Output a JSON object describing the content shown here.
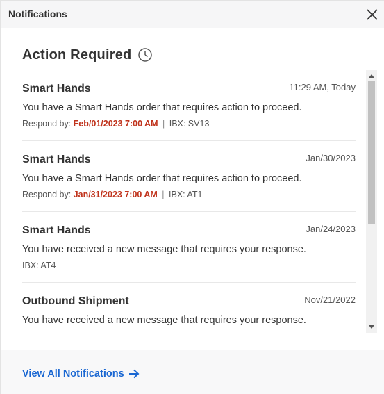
{
  "header": {
    "title": "Notifications"
  },
  "section": {
    "title": "Action Required"
  },
  "items": [
    {
      "title": "Smart Hands",
      "date": "11:29 AM, Today",
      "message": "You have a Smart Hands order that requires action to proceed.",
      "respond_label": "Respond by:",
      "respond_date": "Feb/01/2023 7:00 AM",
      "separator": "|",
      "ibx": "IBX: SV13"
    },
    {
      "title": "Smart Hands",
      "date": "Jan/30/2023",
      "message": "You have a Smart Hands order that requires action to proceed.",
      "respond_label": "Respond by:",
      "respond_date": "Jan/31/2023 7:00 AM",
      "separator": "|",
      "ibx": "IBX: AT1"
    },
    {
      "title": "Smart Hands",
      "date": "Jan/24/2023",
      "message": "You have received a new message that requires your response.",
      "ibx": "IBX: AT4"
    },
    {
      "title": "Outbound Shipment",
      "date": "Nov/21/2022",
      "message": "You have received a new message that requires your response."
    }
  ],
  "footer": {
    "view_all_label": "View All Notifications"
  },
  "colors": {
    "accent": "#1a67d2",
    "urgent": "#c0331c"
  }
}
